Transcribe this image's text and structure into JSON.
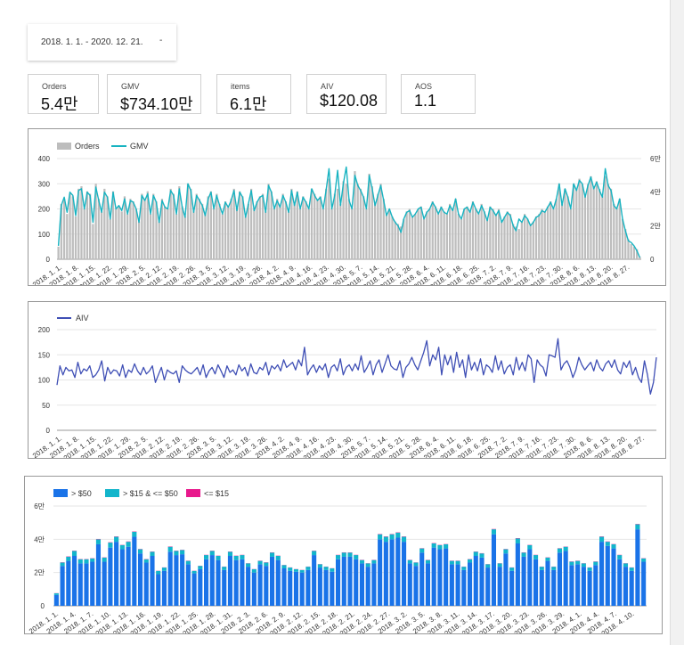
{
  "date_range": {
    "text": "2018. 1. 1. - 2020. 12. 21.",
    "caret": "-"
  },
  "kpis": [
    {
      "label": "Orders",
      "value": "5.4만"
    },
    {
      "label": "GMV",
      "value": "$734.10만"
    },
    {
      "label": "items",
      "value": "6.1만"
    },
    {
      "label": "AIV",
      "value": "$120.08"
    },
    {
      "label": "AOS",
      "value": "1.1"
    }
  ],
  "colors": {
    "orders_bar": "#bdbdbd",
    "gmv_line": "#17b3c1",
    "aiv_line": "#3f4fb5",
    "gt50": "#1a73e8",
    "mid": "#12b5cb",
    "le15": "#e8188c",
    "grid": "#e6e6e6"
  },
  "chart_data": [
    {
      "type": "bar+line",
      "legend": [
        "Orders",
        "GMV"
      ],
      "y_left_ticks": [
        "0",
        "100",
        "200",
        "300",
        "400"
      ],
      "y_left_range": [
        0,
        400
      ],
      "y_right_ticks": [
        "0",
        "2만",
        "4만",
        "6만"
      ],
      "y_right_range": [
        0,
        60000
      ],
      "x_ticks": [
        "2018. 1. 1.",
        "2018. 1. 8.",
        "2018. 1. 15.",
        "2018. 1. 22.",
        "2018. 1. 29.",
        "2018. 2. 5.",
        "2018. 2. 12.",
        "2018. 2. 19.",
        "2018. 2. 26.",
        "2018. 3. 5.",
        "2018. 3. 12.",
        "2018. 3. 19.",
        "2018. 3. 26.",
        "2018. 4. 2.",
        "2018. 4. 9.",
        "2018. 4. 16.",
        "2018. 4. 23.",
        "2018. 4. 30.",
        "2018. 5. 7.",
        "2018. 5. 14.",
        "2018. 5. 21.",
        "2018. 5. 28.",
        "2018. 6. 4.",
        "2018. 6. 11.",
        "2018. 6. 18.",
        "2018. 6. 25.",
        "2018. 7. 2.",
        "2018. 7. 9.",
        "2018. 7. 16.",
        "2018. 7. 23.",
        "2018. 7. 30.",
        "2018. 8. 6.",
        "2018. 8. 13.",
        "2018. 8. 20.",
        "2018. 8. 27."
      ],
      "orders": [
        50,
        220,
        240,
        180,
        260,
        250,
        170,
        280,
        290,
        200,
        270,
        260,
        140,
        300,
        240,
        190,
        280,
        250,
        160,
        270,
        200,
        210,
        190,
        250,
        180,
        240,
        230,
        200,
        150,
        260,
        240,
        270,
        180,
        260,
        230,
        150,
        240,
        210,
        200,
        280,
        260,
        180,
        290,
        210,
        170,
        300,
        280,
        190,
        260,
        240,
        220,
        180,
        250,
        270,
        200,
        260,
        220,
        180,
        230,
        210,
        240,
        280,
        200,
        270,
        250,
        170,
        220,
        280,
        200,
        230,
        250,
        260,
        190,
        300,
        270,
        200,
        240,
        210,
        260,
        230,
        190,
        280,
        220,
        270,
        200,
        250,
        230,
        200,
        280,
        260,
        240,
        250,
        200,
        280,
        320,
        200,
        260,
        280,
        220,
        310,
        300,
        240,
        200,
        350,
        300,
        280,
        250,
        200,
        340,
        290,
        220,
        260,
        300,
        240,
        180,
        200,
        170,
        150,
        140,
        130,
        160,
        190,
        200,
        170,
        180,
        200,
        210,
        160,
        190,
        200,
        230,
        210,
        180,
        210,
        190,
        180,
        220,
        200,
        240,
        180,
        160,
        200,
        210,
        190,
        230,
        200,
        180,
        220,
        190,
        160,
        210,
        200,
        180,
        200,
        150,
        170,
        190,
        180,
        140,
        130,
        120,
        150,
        180,
        160,
        140,
        150,
        170,
        180,
        200,
        190,
        210,
        230,
        200,
        240,
        300,
        220,
        280,
        250,
        200,
        300,
        280,
        320,
        300,
        250,
        300,
        330,
        290,
        310,
        280,
        250,
        330,
        300,
        280,
        220,
        200,
        240,
        160,
        120,
        80,
        60,
        50,
        40,
        10
      ],
      "gmv": [
        8000,
        32000,
        37000,
        28000,
        40000,
        38000,
        26000,
        41000,
        42000,
        30000,
        40000,
        38000,
        22000,
        43000,
        35000,
        28000,
        40000,
        37000,
        24000,
        40000,
        30000,
        32000,
        29000,
        36000,
        27000,
        35000,
        34000,
        30000,
        22000,
        38000,
        35000,
        39000,
        27000,
        38000,
        34000,
        22000,
        35000,
        31000,
        30000,
        41000,
        38000,
        27000,
        42000,
        31000,
        25000,
        45000,
        41000,
        28000,
        38000,
        35000,
        32000,
        26000,
        36000,
        40000,
        30000,
        38000,
        32000,
        27000,
        34000,
        31000,
        35000,
        41000,
        29000,
        40000,
        37000,
        25000,
        33000,
        41000,
        29000,
        34000,
        37000,
        38000,
        28000,
        44000,
        40000,
        30000,
        35000,
        31000,
        38000,
        34000,
        28000,
        41000,
        32000,
        40000,
        30000,
        37000,
        34000,
        30000,
        42000,
        38000,
        35000,
        37000,
        30000,
        41000,
        54000,
        30000,
        38000,
        53000,
        32000,
        45000,
        55000,
        35000,
        30000,
        50000,
        44000,
        41000,
        37000,
        30000,
        50000,
        42000,
        32000,
        38000,
        44000,
        35000,
        26000,
        30000,
        25000,
        22000,
        20000,
        16000,
        24000,
        28000,
        29000,
        25000,
        27000,
        30000,
        31000,
        24000,
        28000,
        30000,
        34000,
        31000,
        27000,
        31000,
        28000,
        27000,
        32000,
        29000,
        36000,
        27000,
        24000,
        30000,
        31000,
        28000,
        34000,
        30000,
        27000,
        32000,
        28000,
        23000,
        31000,
        29000,
        26000,
        29000,
        22000,
        25000,
        28000,
        26000,
        20000,
        17000,
        24000,
        22000,
        26000,
        24000,
        20000,
        22000,
        25000,
        26000,
        29000,
        28000,
        31000,
        34000,
        30000,
        36000,
        45000,
        32000,
        42000,
        37000,
        30000,
        45000,
        41000,
        47000,
        45000,
        37000,
        44000,
        49000,
        42000,
        46000,
        41000,
        37000,
        54000,
        44000,
        41000,
        32000,
        30000,
        36000,
        24000,
        17000,
        11000,
        10000,
        8000,
        5000,
        1000
      ]
    },
    {
      "type": "line",
      "legend": [
        "AIV"
      ],
      "y_ticks": [
        "0",
        "50",
        "100",
        "150",
        "200"
      ],
      "y_range": [
        0,
        200
      ],
      "x_ticks": [
        "2018. 1. 1.",
        "2018. 1. 8.",
        "2018. 1. 15.",
        "2018. 1. 22.",
        "2018. 1. 29.",
        "2018. 2. 5.",
        "2018. 2. 12.",
        "2018. 2. 19.",
        "2018. 2. 26.",
        "2018. 3. 5.",
        "2018. 3. 12.",
        "2018. 3. 19.",
        "2018. 3. 26.",
        "2018. 4. 2.",
        "2018. 4. 9.",
        "2018. 4. 16.",
        "2018. 4. 23.",
        "2018. 4. 30.",
        "2018. 5. 7.",
        "2018. 5. 14.",
        "2018. 5. 21.",
        "2018. 5. 28.",
        "2018. 6. 4.",
        "2018. 6. 11.",
        "2018. 6. 18.",
        "2018. 6. 25.",
        "2018. 7. 2.",
        "2018. 7. 9.",
        "2018. 7. 16.",
        "2018. 7. 23.",
        "2018. 7. 30.",
        "2018. 8. 6.",
        "2018. 8. 13.",
        "2018. 8. 20.",
        "2018. 8. 27."
      ],
      "values": [
        90,
        128,
        110,
        125,
        118,
        120,
        105,
        135,
        112,
        122,
        118,
        128,
        105,
        110,
        120,
        138,
        98,
        125,
        112,
        120,
        118,
        108,
        130,
        105,
        120,
        115,
        132,
        118,
        110,
        125,
        112,
        118,
        128,
        95,
        110,
        125,
        100,
        120,
        115,
        112,
        118,
        95,
        128,
        120,
        115,
        112,
        118,
        125,
        110,
        130,
        105,
        118,
        125,
        112,
        130,
        118,
        105,
        128,
        115,
        120,
        110,
        130,
        118,
        125,
        108,
        132,
        115,
        112,
        125,
        120,
        135,
        110,
        128,
        122,
        130,
        118,
        140,
        125,
        130,
        135,
        120,
        140,
        128,
        165,
        110,
        122,
        130,
        115,
        128,
        120,
        132,
        105,
        125,
        130,
        118,
        142,
        110,
        125,
        130,
        118,
        132,
        120,
        148,
        115,
        125,
        138,
        110,
        130,
        140,
        115,
        132,
        150,
        128,
        122,
        120,
        138,
        105,
        125,
        132,
        145,
        130,
        120,
        138,
        155,
        178,
        128,
        150,
        140,
        165,
        110,
        150,
        130,
        148,
        115,
        155,
        125,
        140,
        105,
        150,
        120,
        135,
        118,
        142,
        110,
        130,
        125,
        115,
        148,
        120,
        138,
        112,
        125,
        130,
        110,
        145,
        120,
        135,
        118,
        150,
        142,
        95,
        140,
        130,
        125,
        108,
        150,
        148,
        145,
        182,
        120,
        132,
        138,
        125,
        105,
        120,
        145,
        130,
        120,
        128,
        135,
        118,
        140,
        125,
        118,
        132,
        138,
        125,
        140,
        120,
        112,
        135,
        125,
        138,
        110,
        125,
        105,
        95,
        138,
        110,
        72,
        95,
        145
      ]
    },
    {
      "type": "stacked-bar",
      "legend": [
        "> $50",
        "> $15 & <= $50",
        "<= $15"
      ],
      "y_ticks": [
        "0",
        "2만",
        "4만",
        "6만"
      ],
      "y_range": [
        0,
        60000
      ],
      "x_ticks": [
        "2018. 1. 1.",
        "2018. 1. 4.",
        "2018. 1. 7.",
        "2018. 1. 10.",
        "2018. 1. 13.",
        "2018. 1. 16.",
        "2018. 1. 19.",
        "2018. 1. 22.",
        "2018. 1. 25.",
        "2018. 1. 28.",
        "2018. 1. 31.",
        "2018. 2. 3.",
        "2018. 2. 6.",
        "2018. 2. 9.",
        "2018. 2. 12.",
        "2018. 2. 15.",
        "2018. 2. 18.",
        "2018. 2. 21.",
        "2018. 2. 24.",
        "2018. 2. 27.",
        "2018. 3. 2.",
        "2018. 3. 5.",
        "2018. 3. 8.",
        "2018. 3. 11.",
        "2018. 3. 14.",
        "2018. 3. 17.",
        "2018. 3. 20.",
        "2018. 3. 23.",
        "2018. 3. 26.",
        "2018. 3. 29.",
        "2018. 4. 1.",
        "2018. 4. 4.",
        "2018. 4. 7.",
        "2018. 4. 10."
      ],
      "gt50": [
        6500,
        24000,
        27000,
        30000,
        25500,
        25500,
        26500,
        37000,
        26500,
        35000,
        38500,
        34000,
        35500,
        41500,
        31500,
        26000,
        30000,
        19000,
        21000,
        32500,
        30500,
        31000,
        25000,
        19500,
        22000,
        28000,
        30500,
        27500,
        21500,
        30000,
        27500,
        28000,
        23500,
        20000,
        25000,
        24000,
        29500,
        27500,
        22500,
        21000,
        20500,
        20000,
        21500,
        30500,
        23000,
        21500,
        20500,
        28000,
        29500,
        29500,
        28000,
        25500,
        23500,
        25500,
        40000,
        38500,
        40000,
        41000,
        38500,
        25500,
        24000,
        32000,
        25500,
        35000,
        34000,
        34500,
        25000,
        25000,
        21500,
        26000,
        30000,
        29000,
        23000,
        43000,
        23500,
        31500,
        21000,
        37500,
        29500,
        34000,
        28000,
        21500,
        27000,
        21500,
        32000,
        33000,
        24500,
        25000,
        23500,
        21000,
        24500,
        38500,
        36000,
        34500,
        28000,
        23500,
        21000,
        46000,
        26500
      ],
      "mid": [
        1000,
        2000,
        2500,
        3000,
        2500,
        2500,
        2000,
        3000,
        2500,
        3000,
        3000,
        2500,
        3000,
        3000,
        2500,
        2000,
        2500,
        2000,
        2000,
        3000,
        2500,
        2500,
        2000,
        1500,
        2000,
        2500,
        2500,
        2500,
        2000,
        2500,
        2500,
        2500,
        2000,
        2000,
        2000,
        2000,
        2500,
        2500,
        2000,
        2000,
        1500,
        1500,
        2000,
        2500,
        2000,
        2000,
        2000,
        2500,
        2500,
        2500,
        2500,
        2000,
        2000,
        2000,
        3000,
        3000,
        3000,
        3000,
        3000,
        2000,
        2000,
        2500,
        2000,
        2500,
        2500,
        2500,
        2000,
        2000,
        2000,
        2000,
        2500,
        2500,
        2000,
        3000,
        2000,
        2500,
        2000,
        3000,
        2500,
        2500,
        2500,
        2000,
        2000,
        2000,
        2500,
        2500,
        2000,
        2000,
        2000,
        2000,
        2000,
        3000,
        2500,
        2500,
        2500,
        2000,
        2000,
        3000,
        2000
      ],
      "le15": [
        100,
        150,
        200,
        150,
        150,
        150,
        150,
        200,
        150,
        200,
        200,
        150,
        200,
        200,
        150,
        150,
        150,
        100,
        100,
        200,
        150,
        150,
        150,
        100,
        100,
        150,
        150,
        150,
        100,
        150,
        150,
        150,
        100,
        100,
        150,
        150,
        150,
        150,
        100,
        100,
        100,
        100,
        100,
        150,
        100,
        100,
        100,
        150,
        150,
        150,
        150,
        150,
        100,
        150,
        200,
        200,
        200,
        200,
        200,
        150,
        100,
        150,
        150,
        200,
        150,
        150,
        150,
        150,
        100,
        150,
        150,
        150,
        100,
        200,
        100,
        150,
        100,
        200,
        150,
        150,
        150,
        100,
        150,
        100,
        150,
        150,
        150,
        150,
        100,
        100,
        150,
        200,
        200,
        150,
        150,
        100,
        100,
        200,
        150
      ]
    }
  ]
}
